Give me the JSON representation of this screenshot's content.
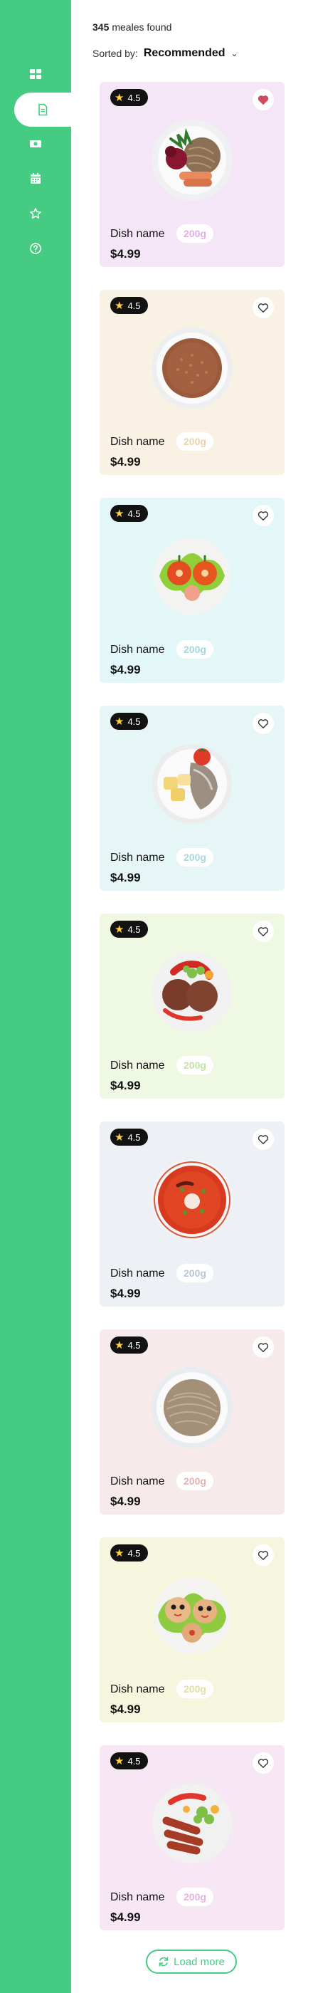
{
  "sidebar": {
    "items": [
      {
        "name": "grid-icon",
        "active": false
      },
      {
        "name": "document-icon",
        "active": true
      },
      {
        "name": "money-icon",
        "active": false
      },
      {
        "name": "calendar-icon",
        "active": false
      },
      {
        "name": "star-icon",
        "active": false
      },
      {
        "name": "help-icon",
        "active": false
      }
    ],
    "color": "#45cc82"
  },
  "results": {
    "count": "345",
    "label": "meales found"
  },
  "sort": {
    "label": "Sorted by:",
    "value": "Recommended"
  },
  "cards": [
    {
      "rating": "4.5",
      "name": "Dish name",
      "weight": "200g",
      "price": "$4.99",
      "favorited": true,
      "bg": "#f4e6f6",
      "weight_color": "#e0aee0",
      "dish": "beet-noodles-sausage"
    },
    {
      "rating": "4.5",
      "name": "Dish name",
      "weight": "200g",
      "price": "$4.99",
      "favorited": false,
      "bg": "#f9f2e4",
      "weight_color": "#e9d3ac",
      "dish": "buckwheat"
    },
    {
      "rating": "4.5",
      "name": "Dish name",
      "weight": "200g",
      "price": "$4.99",
      "favorited": false,
      "bg": "#e4f7f8",
      "weight_color": "#9fd8dd",
      "dish": "stuffed-tomatoes"
    },
    {
      "rating": "4.5",
      "name": "Dish name",
      "weight": "200g",
      "price": "$4.99",
      "favorited": false,
      "bg": "#e6f6f6",
      "weight_color": "#a6dadd",
      "dish": "fish-potatoes"
    },
    {
      "rating": "4.5",
      "name": "Dish name",
      "weight": "200g",
      "price": "$4.99",
      "favorited": false,
      "bg": "#eef8e2",
      "weight_color": "#c4e3a6",
      "dish": "cutlets-vegetables"
    },
    {
      "rating": "4.5",
      "name": "Dish name",
      "weight": "200g",
      "price": "$4.99",
      "favorited": false,
      "bg": "#edf1f5",
      "weight_color": "#b7c7d8",
      "dish": "borscht"
    },
    {
      "rating": "4.5",
      "name": "Dish name",
      "weight": "200g",
      "price": "$4.99",
      "favorited": false,
      "bg": "#f6eaea",
      "weight_color": "#e3b3b3",
      "dish": "noodles"
    },
    {
      "rating": "4.5",
      "name": "Dish name",
      "weight": "200g",
      "price": "$4.99",
      "favorited": false,
      "bg": "#f6f6de",
      "weight_color": "#e0e0a4",
      "dish": "decorated-buns"
    },
    {
      "rating": "4.5",
      "name": "Dish name",
      "weight": "200g",
      "price": "$4.99",
      "favorited": false,
      "bg": "#f7e6f4",
      "weight_color": "#e2b4dc",
      "dish": "sausages-vegetables"
    }
  ],
  "load_more": {
    "label": "Load more"
  }
}
